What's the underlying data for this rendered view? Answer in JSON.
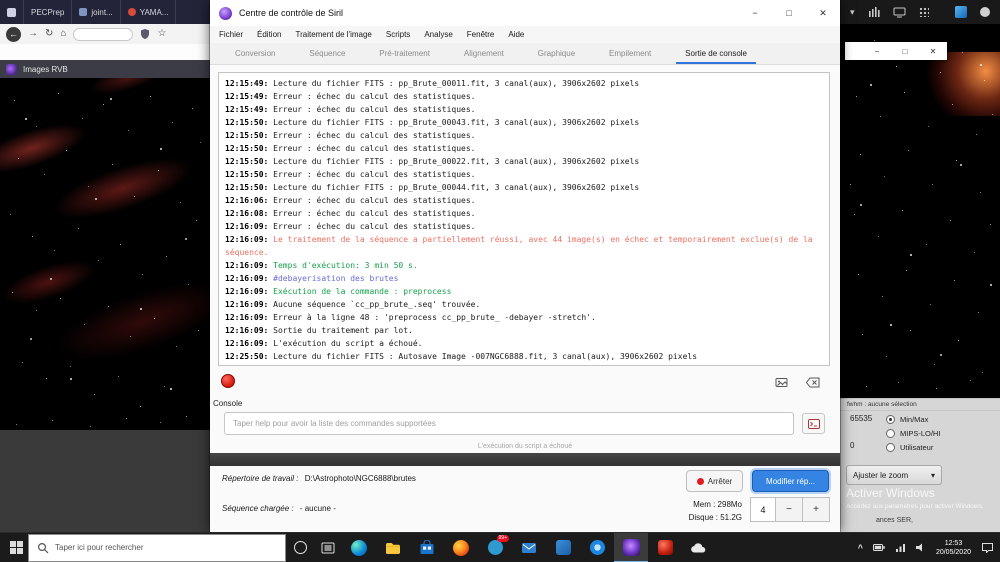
{
  "background_left": {
    "window_tabs": [
      "PECPrep",
      "joint...",
      "YAMA..."
    ],
    "image_window_title": "Images RVB"
  },
  "siril": {
    "window_title": "Centre de contrôle de Siril",
    "menu": [
      "Fichier",
      "Édition",
      "Traitement de l'image",
      "Scripts",
      "Analyse",
      "Fenêtre",
      "Aide"
    ],
    "tabs": [
      {
        "label": "Conversion",
        "active": false
      },
      {
        "label": "Séquence",
        "active": false
      },
      {
        "label": "Pré-traitement",
        "active": false
      },
      {
        "label": "Alignement",
        "active": false
      },
      {
        "label": "Graphique",
        "active": false
      },
      {
        "label": "Empilement",
        "active": false
      },
      {
        "label": "Sortie de console",
        "active": true
      }
    ],
    "console_log": [
      {
        "time": "12:15:49",
        "text": "Lecture du fichier FITS : pp_Brute_00011.fit, 3 canal(aux), 3906x2602 pixels",
        "color": "default"
      },
      {
        "time": "12:15:49",
        "text": "Erreur : échec du calcul des statistiques.",
        "color": "default"
      },
      {
        "time": "12:15:49",
        "text": "Erreur : échec du calcul des statistiques.",
        "color": "default"
      },
      {
        "time": "12:15:50",
        "text": "Lecture du fichier FITS : pp_Brute_00043.fit, 3 canal(aux), 3906x2602 pixels",
        "color": "default"
      },
      {
        "time": "12:15:50",
        "text": "Erreur : échec du calcul des statistiques.",
        "color": "default"
      },
      {
        "time": "12:15:50",
        "text": "Erreur : échec du calcul des statistiques.",
        "color": "default"
      },
      {
        "time": "12:15:50",
        "text": "Lecture du fichier FITS : pp_Brute_00022.fit, 3 canal(aux), 3906x2602 pixels",
        "color": "default"
      },
      {
        "time": "12:15:50",
        "text": "Erreur : échec du calcul des statistiques.",
        "color": "default"
      },
      {
        "time": "12:15:50",
        "text": "Lecture du fichier FITS : pp_Brute_00044.fit, 3 canal(aux), 3906x2602 pixels",
        "color": "default"
      },
      {
        "time": "12:16:06",
        "text": "Erreur : échec du calcul des statistiques.",
        "color": "default"
      },
      {
        "time": "12:16:08",
        "text": "Erreur : échec du calcul des statistiques.",
        "color": "default"
      },
      {
        "time": "12:16:09",
        "text": "Erreur : échec du calcul des statistiques.",
        "color": "default"
      },
      {
        "time": "12:16:09",
        "text": "Le traitement de la séquence a partiellement réussi, avec 44 image(s) en échec et temporairement exclue(s) de la séquence.",
        "color": "red"
      },
      {
        "time": "12:16:09",
        "text": "Temps d'exécution: 3 min 50 s.",
        "color": "green"
      },
      {
        "time": "12:16:09",
        "text": "#debayerisation des brutes",
        "color": "blue"
      },
      {
        "time": "12:16:09",
        "text": "Exécution de la commande : preprocess",
        "color": "green"
      },
      {
        "time": "12:16:09",
        "text": "Aucune séquence `cc_pp_brute_.seq' trouvée.",
        "color": "default"
      },
      {
        "time": "12:16:09",
        "text": "Erreur à la ligne 48 : 'preprocess cc_pp_brute_ -debayer -stretch'.",
        "color": "default"
      },
      {
        "time": "12:16:09",
        "text": "Sortie du traitement par lot.",
        "color": "default"
      },
      {
        "time": "12:16:09",
        "text": "L'exécution du script a échoué.",
        "color": "default"
      },
      {
        "time": "12:25:50",
        "text": "Lecture du fichier FITS : Autosave Image -007NGC6888.fit, 3 canal(aux), 3906x2602 pixels",
        "color": "default"
      }
    ],
    "console_frame_label": "Console",
    "command_input_placeholder": "Taper help pour avoir la liste des commandes supportées",
    "progress_text": "L'exécution du script a échoué",
    "workdir_label": "Répertoire de travail :",
    "workdir_value": "D:\\Astrophoto\\NGC6888\\brutes",
    "stop_button_label": "Arrêter",
    "change_dir_button_label": "Modifier rép...",
    "sequence_label": "Séquence chargée :",
    "sequence_value": "- aucune -",
    "memory_text": "Mem : 298Mo",
    "disk_text": "Disque : 51.2G",
    "spinner_value": "4",
    "spinner_minus": "−",
    "spinner_plus": "+"
  },
  "right_panel": {
    "fwhm_text": "fwhm : aucune sélection",
    "hi_value": "65535",
    "lo_value": "0",
    "display_modes": [
      "Min/Max",
      "MIPS-LO/HI",
      "Utilisateur"
    ],
    "selected_mode": 0,
    "zoom_button_label": "Ajuster le zoom",
    "partial_text": "ances SER,"
  },
  "watermark": {
    "line1": "Activer Windows",
    "line2": "Accédez aux paramètres pour activer Windows."
  },
  "taskbar": {
    "search_placeholder": "Taper ici pour rechercher",
    "badge_count": "99+",
    "clock_time": "12:53",
    "clock_date": "20/05/2020"
  }
}
